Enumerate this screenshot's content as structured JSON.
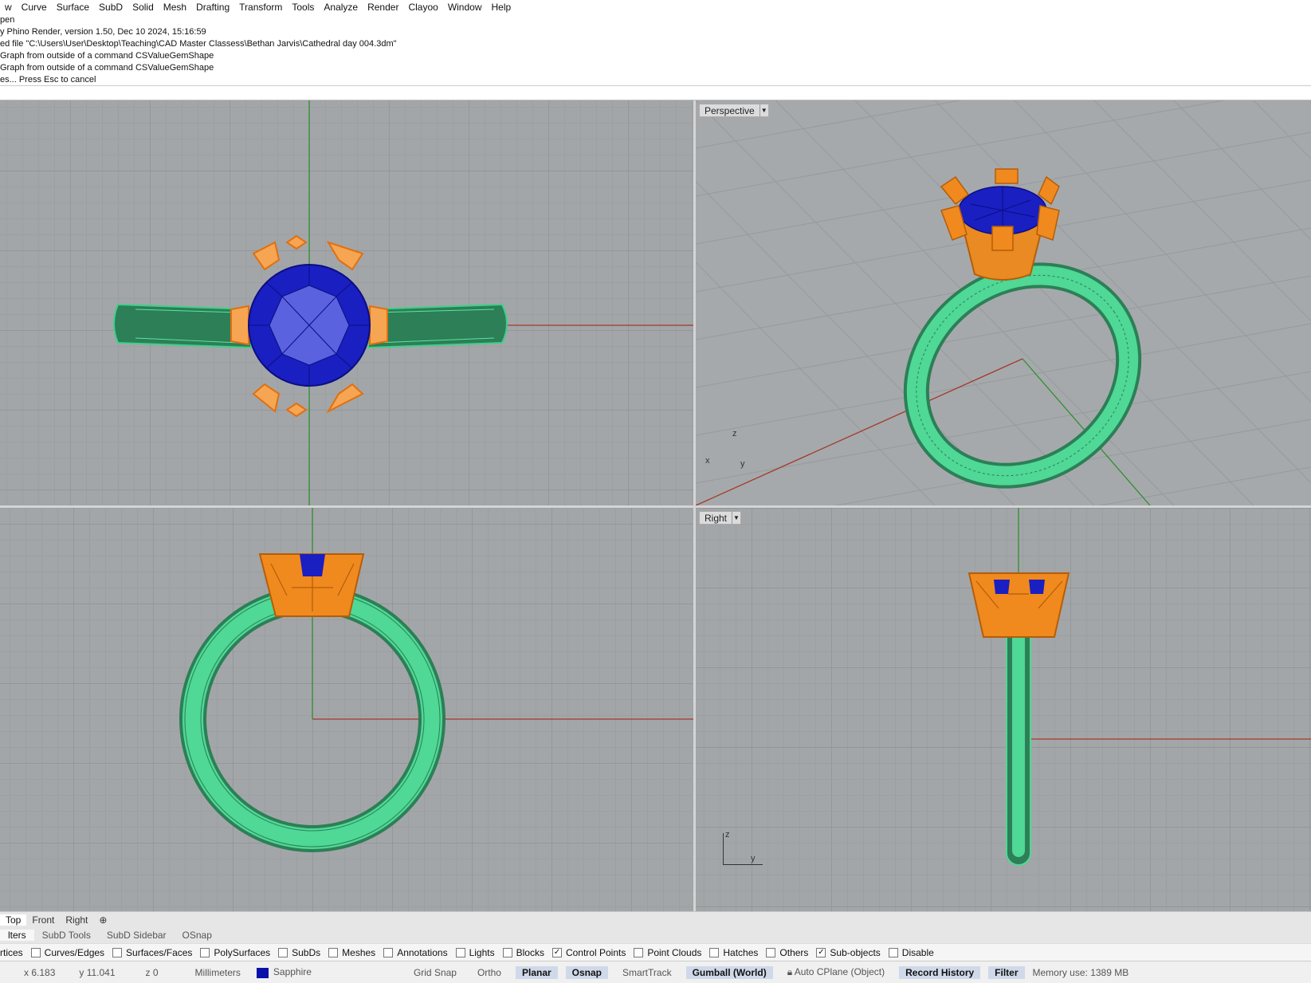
{
  "menu": [
    "w",
    "Curve",
    "Surface",
    "SubD",
    "Solid",
    "Mesh",
    "Drafting",
    "Transform",
    "Tools",
    "Analyze",
    "Render",
    "Clayoo",
    "Window",
    "Help"
  ],
  "command_history": [
    "pen",
    "y Phino Render, version 1.50, Dec 10 2024, 15:16:59",
    "ed file \"C:\\Users\\User\\Desktop\\Teaching\\CAD Master Classess\\Bethan Jarvis\\Cathedral day 004.3dm\"",
    " Graph from outside of a command CSValueGemShape",
    " Graph from outside of a command CSValueGemShape",
    "es... Press Esc to cancel"
  ],
  "viewports": {
    "perspective": {
      "name": "Perspective"
    },
    "right": {
      "name": "Right"
    }
  },
  "axis_labels": {
    "z": "z",
    "x": "x",
    "y": "y"
  },
  "viewport_tabs": [
    "Top",
    "Front",
    "Right",
    "⊕"
  ],
  "panel_tabs": [
    "lters",
    "SubD Tools",
    "SubD Sidebar",
    "OSnap"
  ],
  "filters": [
    {
      "label": "rtices",
      "checked": null
    },
    {
      "label": "Curves/Edges",
      "checked": false
    },
    {
      "label": "Surfaces/Faces",
      "checked": false
    },
    {
      "label": "PolySurfaces",
      "checked": false
    },
    {
      "label": "SubDs",
      "checked": false
    },
    {
      "label": "Meshes",
      "checked": false
    },
    {
      "label": "Annotations",
      "checked": false
    },
    {
      "label": "Lights",
      "checked": false
    },
    {
      "label": "Blocks",
      "checked": false
    },
    {
      "label": "Control Points",
      "checked": true
    },
    {
      "label": "Point Clouds",
      "checked": false
    },
    {
      "label": "Hatches",
      "checked": false
    },
    {
      "label": "Others",
      "checked": false
    },
    {
      "label": "Sub-objects",
      "checked": true
    },
    {
      "label": "Disable",
      "checked": false
    }
  ],
  "status": {
    "x": "x 6.183",
    "y": "y 11.041",
    "z": "z 0",
    "units": "Millimeters",
    "layer": "Sapphire",
    "layer_color": "#0a11a8",
    "toggles": [
      {
        "label": "Grid Snap",
        "active": false
      },
      {
        "label": "Ortho",
        "active": false
      },
      {
        "label": "Planar",
        "active": true
      },
      {
        "label": "Osnap",
        "active": true
      },
      {
        "label": "SmartTrack",
        "active": false
      },
      {
        "label": "Gumball (World)",
        "active": true
      },
      {
        "label": "Auto CPlane (Object)",
        "active": false
      },
      {
        "label": "Record History",
        "active": true
      },
      {
        "label": "Filter",
        "active": true
      }
    ],
    "memory": "Memory use: 1389 MB"
  },
  "colors": {
    "ring": "#3fcf8a",
    "prong": "#f08a1e",
    "gem": "#1520c8",
    "grid_bg": "#a3a6a8"
  }
}
